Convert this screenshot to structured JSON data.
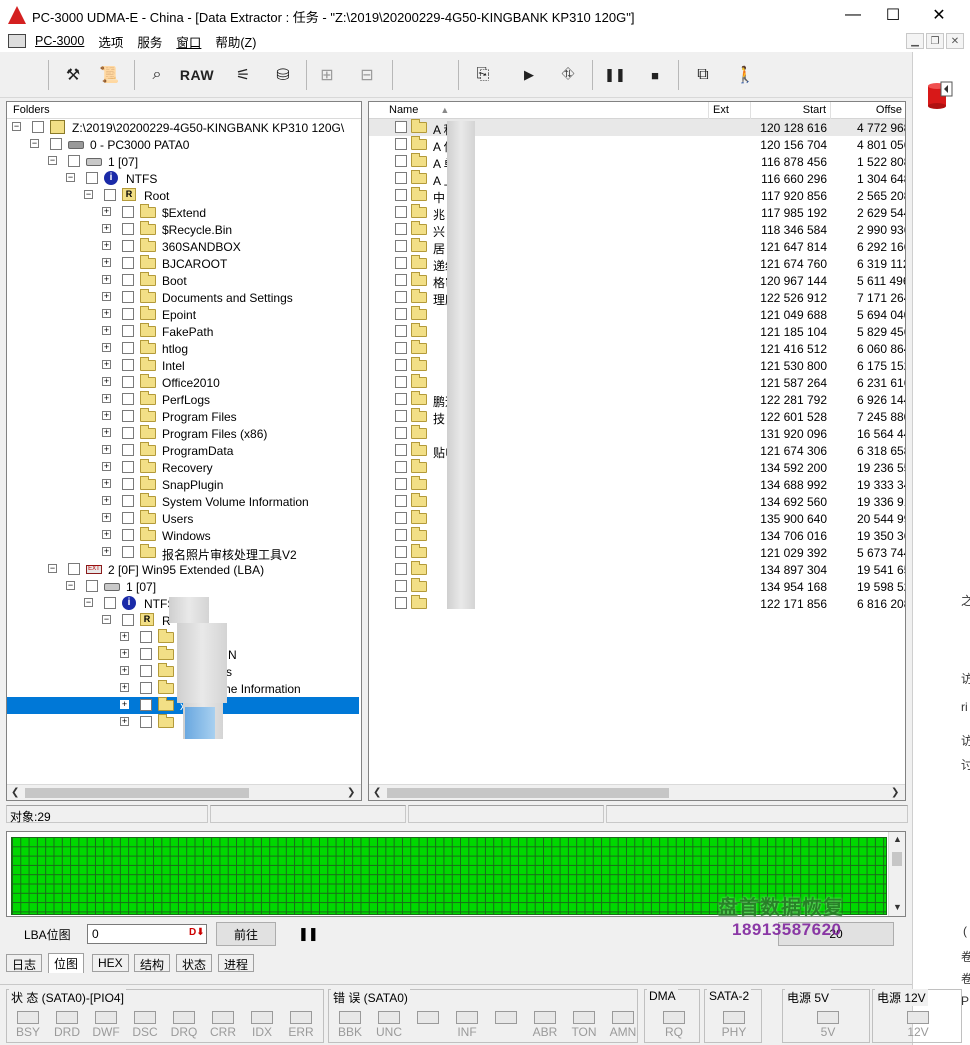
{
  "window": {
    "title": "PC-3000 UDMA-E - China - [Data Extractor : 任务 - \"Z:\\2019\\20200229-4G50-KINGBANK KP310 120G\"]"
  },
  "menu": [
    {
      "label": "PC-3000",
      "mnemonic": ""
    },
    {
      "label": "选项",
      "mnemonic": ""
    },
    {
      "label": "服务",
      "mnemonic": ""
    },
    {
      "label": "窗口",
      "mnemonic": ""
    },
    {
      "label": "帮助(Z)",
      "mnemonic": ""
    }
  ],
  "toolbar": {
    "raw_label": "RAW"
  },
  "folders": {
    "header": "Folders",
    "rows": [
      {
        "indent": 0,
        "toggle": "−",
        "icon": "folder-special",
        "label": "Z:\\2019\\20200229-4G50-KINGBANK KP310 120G\\"
      },
      {
        "indent": 1,
        "toggle": "−",
        "icon": "device",
        "label": "0 - PC3000 PATA0"
      },
      {
        "indent": 2,
        "toggle": "−",
        "icon": "disk",
        "label": "1 [07]"
      },
      {
        "indent": 3,
        "toggle": "−",
        "icon": "info",
        "label": "NTFS"
      },
      {
        "indent": 4,
        "toggle": "−",
        "icon": "root",
        "label": "Root"
      },
      {
        "indent": 5,
        "toggle": "+",
        "icon": "folder",
        "label": "$Extend"
      },
      {
        "indent": 5,
        "toggle": "+",
        "icon": "folder",
        "label": "$Recycle.Bin"
      },
      {
        "indent": 5,
        "toggle": "+",
        "icon": "folder",
        "label": "360SANDBOX"
      },
      {
        "indent": 5,
        "toggle": "+",
        "icon": "folder",
        "label": "BJCAROOT"
      },
      {
        "indent": 5,
        "toggle": "+",
        "icon": "folder",
        "label": "Boot"
      },
      {
        "indent": 5,
        "toggle": "+",
        "icon": "folder",
        "label": "Documents and Settings"
      },
      {
        "indent": 5,
        "toggle": "+",
        "icon": "folder",
        "label": "Epoint"
      },
      {
        "indent": 5,
        "toggle": "+",
        "icon": "folder",
        "label": "FakePath"
      },
      {
        "indent": 5,
        "toggle": "+",
        "icon": "folder",
        "label": "htlog"
      },
      {
        "indent": 5,
        "toggle": "+",
        "icon": "folder",
        "label": "Intel"
      },
      {
        "indent": 5,
        "toggle": "+",
        "icon": "folder",
        "label": "Office2010"
      },
      {
        "indent": 5,
        "toggle": "+",
        "icon": "folder",
        "label": "PerfLogs"
      },
      {
        "indent": 5,
        "toggle": "+",
        "icon": "folder",
        "label": "Program Files"
      },
      {
        "indent": 5,
        "toggle": "+",
        "icon": "folder",
        "label": "Program Files (x86)"
      },
      {
        "indent": 5,
        "toggle": "+",
        "icon": "folder",
        "label": "ProgramData"
      },
      {
        "indent": 5,
        "toggle": "+",
        "icon": "folder",
        "label": "Recovery"
      },
      {
        "indent": 5,
        "toggle": "+",
        "icon": "folder",
        "label": "SnapPlugin"
      },
      {
        "indent": 5,
        "toggle": "+",
        "icon": "folder",
        "label": "System Volume Information"
      },
      {
        "indent": 5,
        "toggle": "+",
        "icon": "folder",
        "label": "Users"
      },
      {
        "indent": 5,
        "toggle": "+",
        "icon": "folder",
        "label": "Windows"
      },
      {
        "indent": 5,
        "toggle": "+",
        "icon": "folder",
        "label": "报名照片审核处理工具V2"
      },
      {
        "indent": 2,
        "toggle": "−",
        "icon": "partition",
        "label": "2 [0F] Win95 Extended  (LBA)"
      },
      {
        "indent": 3,
        "toggle": "−",
        "icon": "disk",
        "label": "1 [07]"
      },
      {
        "indent": 4,
        "toggle": "−",
        "icon": "info",
        "label": "NTFS - "
      },
      {
        "indent": 5,
        "toggle": "−",
        "icon": "root",
        "label": "R"
      },
      {
        "indent": 6,
        "toggle": "+",
        "icon": "folder",
        "label": ""
      },
      {
        "indent": 6,
        "toggle": "+",
        "icon": "folder",
        "label": "$R          LE.BIN"
      },
      {
        "indent": 6,
        "toggle": "+",
        "icon": "folder",
        "label": "36        nloads"
      },
      {
        "indent": 6,
        "toggle": "+",
        "icon": "folder",
        "label": "Sy       Volume Information"
      },
      {
        "indent": 6,
        "toggle": "+",
        "icon": "folder",
        "label": "x        ni",
        "selected": true
      },
      {
        "indent": 6,
        "toggle": "+",
        "icon": "folder",
        "label": ""
      }
    ]
  },
  "list": {
    "columns": {
      "name": "Name",
      "ext": "Ext",
      "start": "Start",
      "offset": "Offse"
    },
    "rows": [
      {
        "name": "A           积金",
        "start": "120 128 616",
        "offset": "4 772 968"
      },
      {
        "name": "A           保",
        "start": "120 156 704",
        "offset": "4 801 056"
      },
      {
        "name": "A           单位",
        "start": "116 878 456",
        "offset": "1 522 808"
      },
      {
        "name": "A           上保",
        "start": "116 660 296",
        "offset": "1 304 648"
      },
      {
        "name": "中",
        "start": "117 920 856",
        "offset": "2 565 208"
      },
      {
        "name": "兆",
        "start": "117 985 192",
        "offset": "2 629 544"
      },
      {
        "name": "兴           装",
        "start": "118 346 584",
        "offset": "2 990 936"
      },
      {
        "name": "居",
        "start": "121 647 814",
        "offset": "6 292 166"
      },
      {
        "name": "                递续延",
        "start": "121 674 760",
        "offset": "6 319 112"
      },
      {
        "name": "                格审查",
        "start": "120 967 144",
        "offset": "5 611 496"
      },
      {
        "name": "                理所",
        "start": "122 526 912",
        "offset": "7 171 264"
      },
      {
        "name": "",
        "start": "121 049 688",
        "offset": "5 694 040"
      },
      {
        "name": "",
        "start": "121 185 104",
        "offset": "5 829 456"
      },
      {
        "name": "",
        "start": "121 416 512",
        "offset": "6 060 864"
      },
      {
        "name": "",
        "start": "121 530 800",
        "offset": "6 175 152"
      },
      {
        "name": "",
        "start": "121 587 264",
        "offset": "6 231 616"
      },
      {
        "name": "                鹏远",
        "start": "122 281 792",
        "offset": "6 926 144"
      },
      {
        "name": "                技",
        "start": "122 601 528",
        "offset": "7 245 880"
      },
      {
        "name": "",
        "start": "131 920 096",
        "offset": "16 564 448"
      },
      {
        "name": "                贴申请",
        "start": "121 674 306",
        "offset": "6 318 658"
      },
      {
        "name": "",
        "start": "134 592 200",
        "offset": "19 236 552"
      },
      {
        "name": "",
        "start": "134 688 992",
        "offset": "19 333 344"
      },
      {
        "name": "",
        "start": "134 692 560",
        "offset": "19 336 912"
      },
      {
        "name": "",
        "start": "135 900 640",
        "offset": "20 544 992"
      },
      {
        "name": "",
        "start": "134 706 016",
        "offset": "19 350 368"
      },
      {
        "name": "",
        "start": "121 029 392",
        "offset": "5 673 744"
      },
      {
        "name": "",
        "start": "134 897 304",
        "offset": "19 541 656"
      },
      {
        "name": "",
        "start": "134 954 168",
        "offset": "19 598 520"
      },
      {
        "name": "",
        "start": "122 171 856",
        "offset": "6 816 208"
      }
    ]
  },
  "status": {
    "objects": "对象:29"
  },
  "lba": {
    "label": "LBA位图",
    "value": "0",
    "prev_button": "前往",
    "right_button_suffix": "20"
  },
  "watermark": {
    "line1": "盘首数据恢复",
    "line2": "18913587620"
  },
  "tabs": [
    "日志",
    "位图",
    "HEX",
    "结构",
    "状态",
    "进程"
  ],
  "indicators": {
    "groups": [
      {
        "title": "状 态 (SATA0)-[PIO4]",
        "leds": [
          "BSY",
          "DRD",
          "DWF",
          "DSC",
          "DRQ",
          "CRR",
          "IDX",
          "ERR"
        ]
      },
      {
        "title": "错 误 (SATA0)",
        "leds": [
          "BBK",
          "UNC",
          "",
          "INF",
          "",
          "ABR",
          "TON",
          "AMN"
        ]
      },
      {
        "title": "DMA",
        "leds": [
          "RQ"
        ]
      },
      {
        "title": "SATA-2",
        "leds": [
          "PHY"
        ]
      },
      {
        "title": "电源 5V",
        "leds": [
          "5V"
        ]
      },
      {
        "title": "电源 12V",
        "leds": [
          "12V"
        ]
      }
    ]
  },
  "side_fragments": [
    "之",
    "访",
    "ri",
    "访",
    "讨",
    "(",
    "卷",
    "卷",
    "P"
  ]
}
